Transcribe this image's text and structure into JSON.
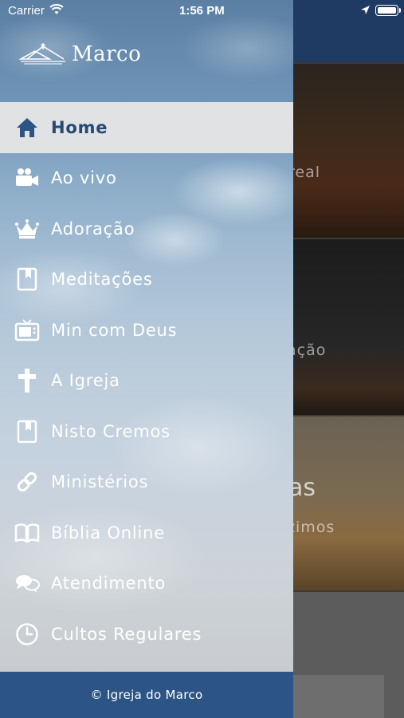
{
  "status_bar": {
    "carrier": "Carrier",
    "time": "1:56 PM",
    "wifi_icon": "wifi-icon",
    "location_icon": "location-arrow-icon",
    "battery_icon": "battery-icon"
  },
  "drawer": {
    "logo_text": "Marco",
    "menu": [
      {
        "label": "Home",
        "icon": "home-icon",
        "active": true
      },
      {
        "label": "Ao vivo",
        "icon": "video-camera-icon",
        "active": false
      },
      {
        "label": "Adoração",
        "icon": "crown-icon",
        "active": false
      },
      {
        "label": "Meditações",
        "icon": "bookmark-book-icon",
        "active": false
      },
      {
        "label": "Min com Deus",
        "icon": "tv-icon",
        "active": false
      },
      {
        "label": "A Igreja",
        "icon": "cross-icon",
        "active": false
      },
      {
        "label": "Nisto Cremos",
        "icon": "bookmark-book-icon",
        "active": false
      },
      {
        "label": "Ministérios",
        "icon": "link-icon",
        "active": false
      },
      {
        "label": "Bíblia Online",
        "icon": "open-book-icon",
        "active": false
      },
      {
        "label": "Atendimento",
        "icon": "chat-bubbles-icon",
        "active": false
      },
      {
        "label": "Cultos Regulares",
        "icon": "clock-icon",
        "active": false
      }
    ],
    "footer": "© Igreja do Marco"
  },
  "background_app": {
    "card1_text": "real",
    "card2_text": "ação",
    "card3_title": "as",
    "card3_text": "zimos"
  },
  "colors": {
    "accent_blue": "#2c5585",
    "active_label": "#244a73",
    "active_bg": "#e6e6e6",
    "header_blue": "#1f3a63"
  }
}
